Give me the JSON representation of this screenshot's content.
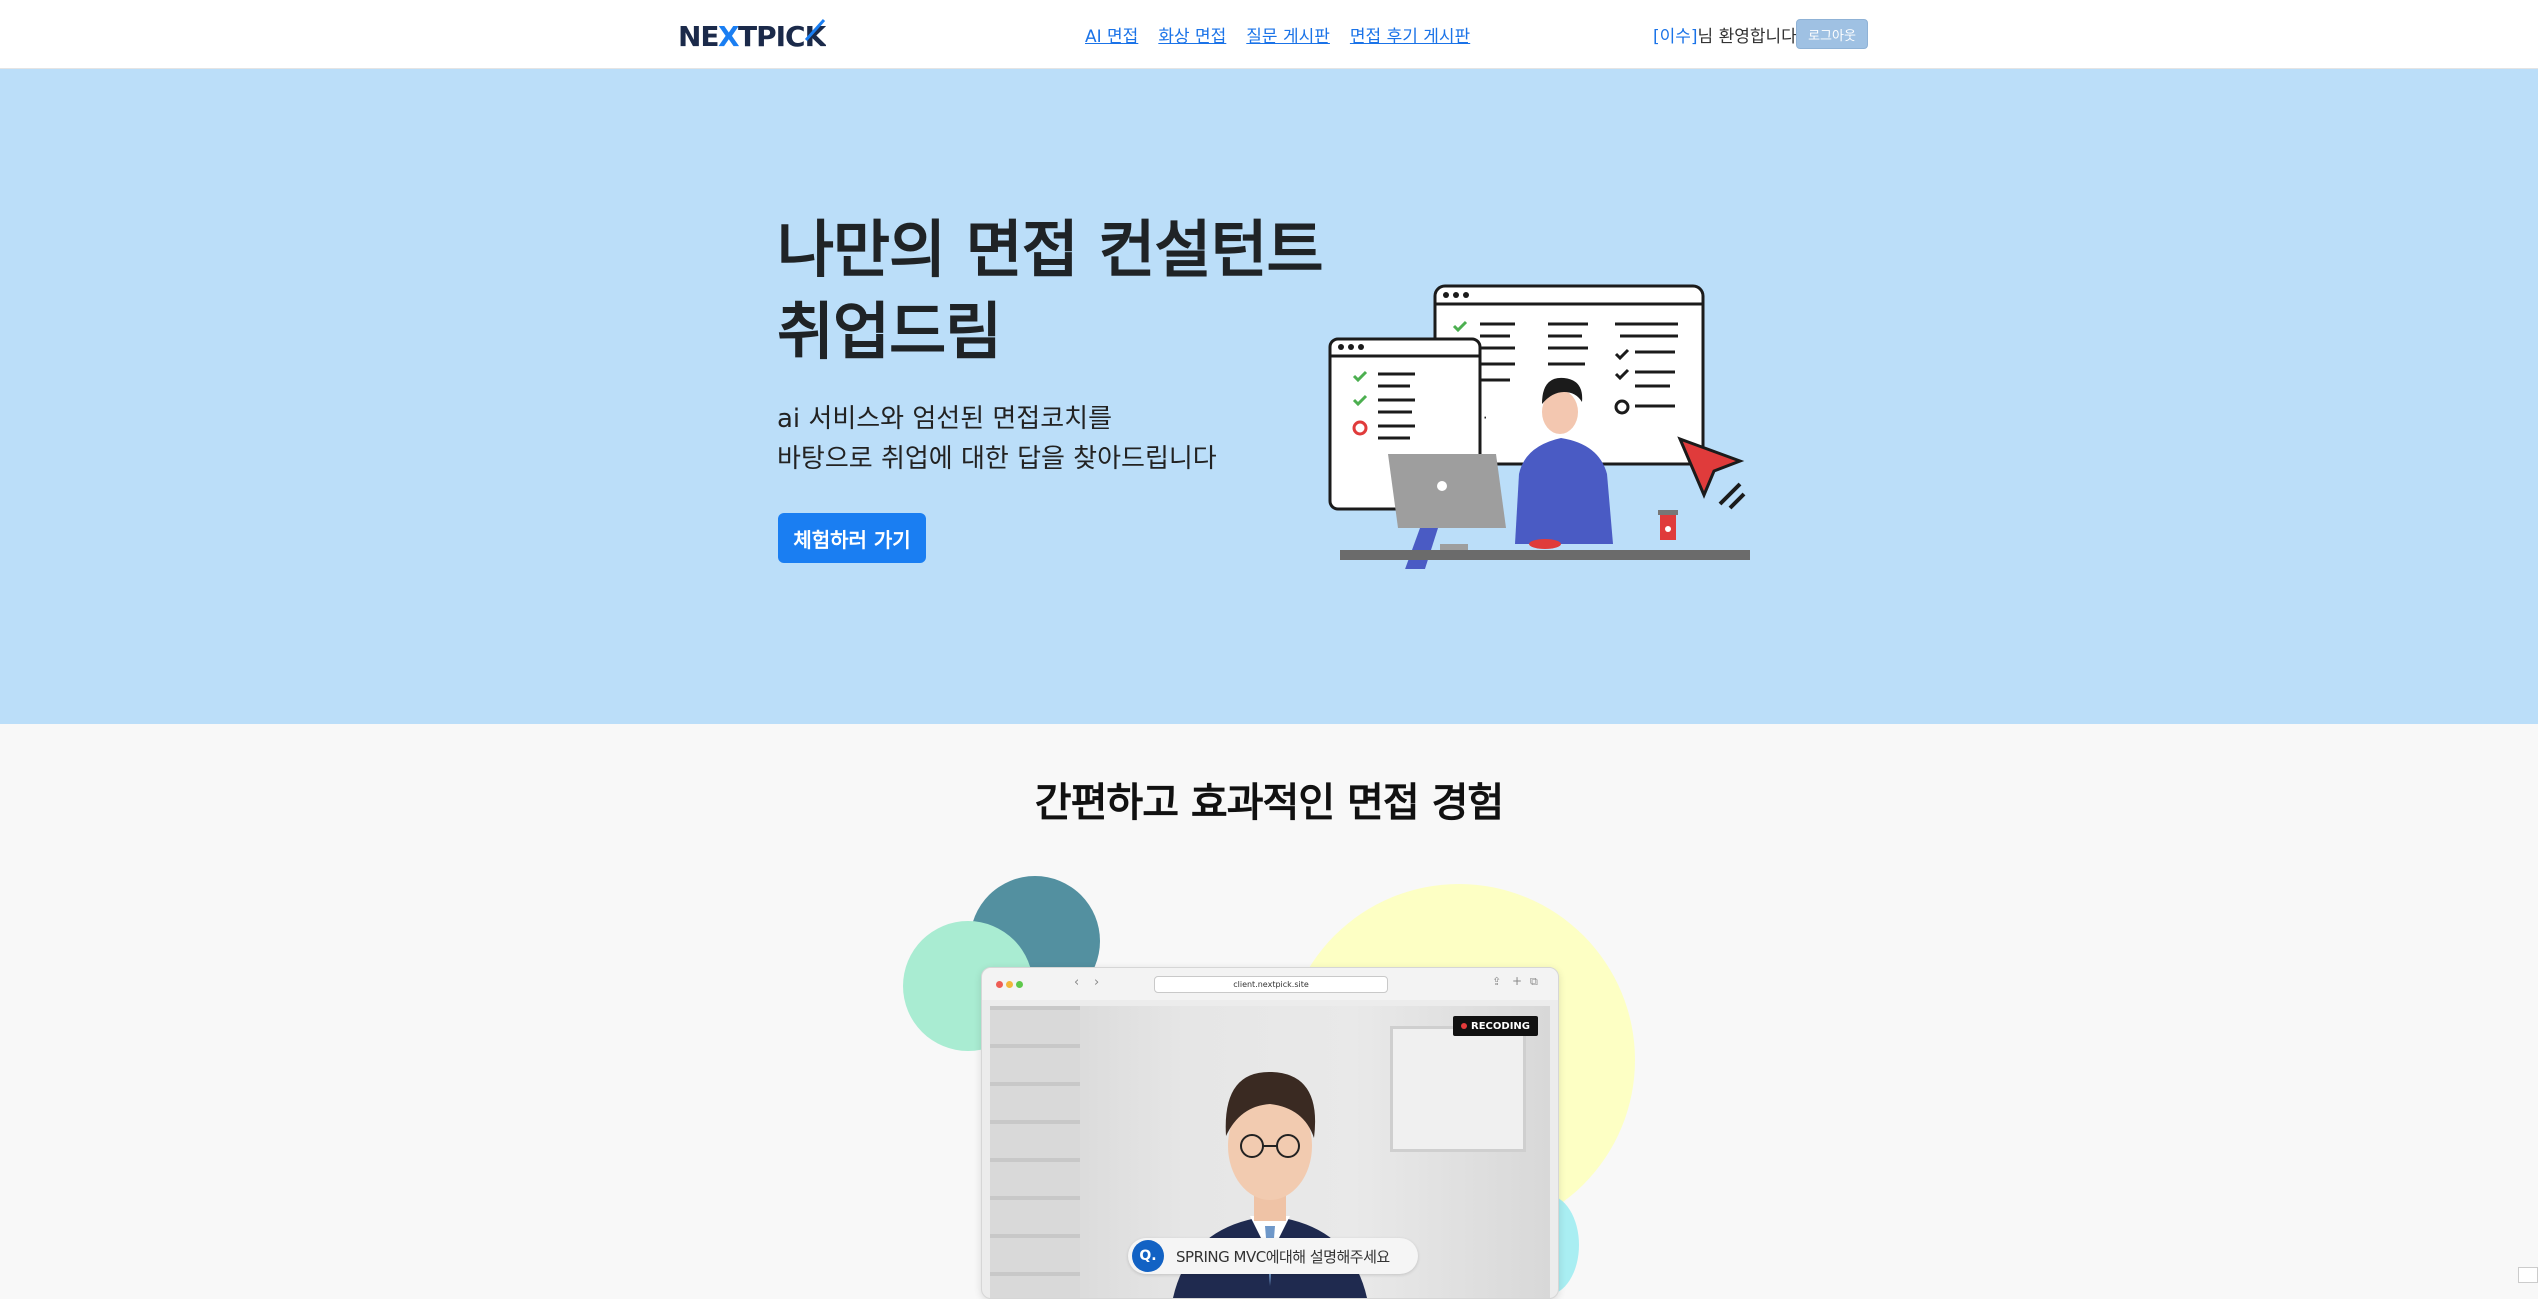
{
  "header": {
    "logo_text": "NEXTPICK",
    "nav": [
      "AI 면접",
      "화상 면접",
      "질문 게시판",
      "면접 후기 게시판"
    ],
    "welcome_name": "[이수]",
    "welcome_text": "님 환영합니다!",
    "logout_label": "로그아웃"
  },
  "hero": {
    "title_line1": "나만의 면접 컨설턴트",
    "title_line2": "취업드림",
    "subtitle_line1": "ai 서비스와 엄선된 면접코치를",
    "subtitle_line2": "바탕으로 취업에 대한 답을 찾아드립니다",
    "cta_label": "체험하러 가기"
  },
  "features": {
    "title": "간편하고 효과적인 면접 경험",
    "browser_url": "client.nextpick.site",
    "recording_label": "RECODING",
    "question_mark": "Q.",
    "question_text": "SPRING MVC에대해 설명해주세요"
  },
  "colors": {
    "accent": "#1a7ef2",
    "link": "#1a73e8",
    "hero_bg": "#bbdef9",
    "logout_bg": "#9fc1e3"
  }
}
